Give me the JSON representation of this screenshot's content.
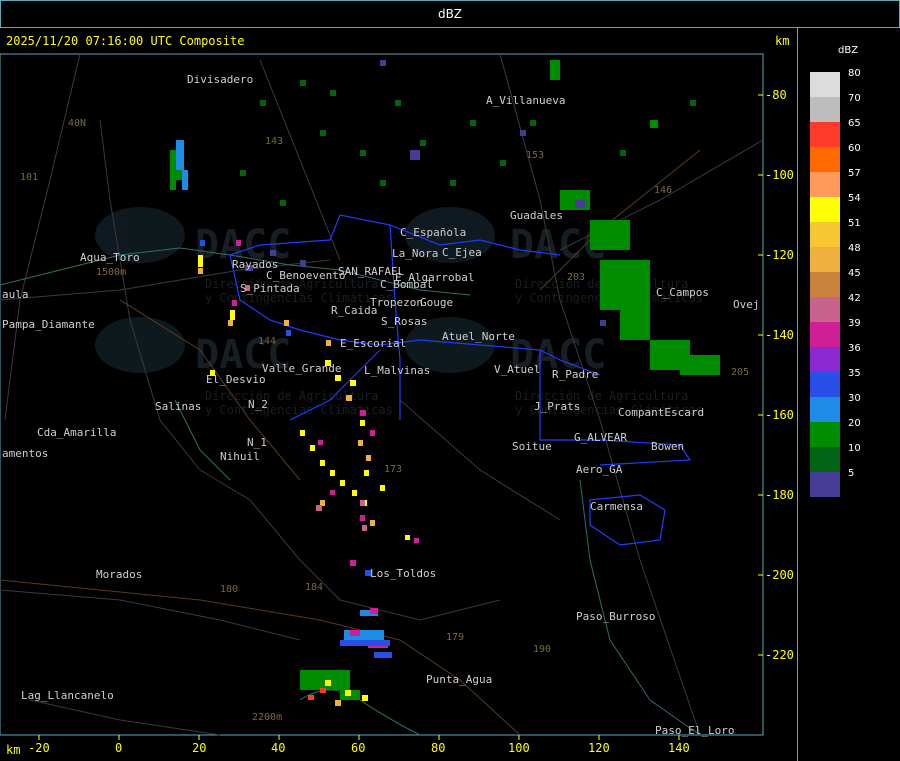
{
  "window": {
    "title": "dBZ"
  },
  "header": {
    "timestamp_label": "2025/11/20 07:16:00 UTC Composite",
    "unit_right": "km",
    "unit_bottom": "km"
  },
  "axes": {
    "x_ticks": [
      "-20",
      "0",
      "20",
      "40",
      "60",
      "80",
      "100",
      "120",
      "140"
    ],
    "y_ticks": [
      "-80",
      "-100",
      "-120",
      "-140",
      "-160",
      "-180",
      "-200",
      "-220"
    ]
  },
  "legend": {
    "title": "dBZ",
    "entries": [
      {
        "label": "80",
        "color": "#dcdcdc"
      },
      {
        "label": "70",
        "color": "#bdbdbd"
      },
      {
        "label": "65",
        "color": "#ff3a28"
      },
      {
        "label": "60",
        "color": "#ff6a00"
      },
      {
        "label": "57",
        "color": "#ff9a5a"
      },
      {
        "label": "54",
        "color": "#ffff00"
      },
      {
        "label": "51",
        "color": "#f8c832"
      },
      {
        "label": "48",
        "color": "#f0b040"
      },
      {
        "label": "45",
        "color": "#c8823c"
      },
      {
        "label": "42",
        "color": "#c8648c"
      },
      {
        "label": "39",
        "color": "#d01e96"
      },
      {
        "label": "36",
        "color": "#8c28d2"
      },
      {
        "label": "35",
        "color": "#2850e6"
      },
      {
        "label": "30",
        "color": "#1e8ce6"
      },
      {
        "label": "20",
        "color": "#008c00"
      },
      {
        "label": "10",
        "color": "#006414"
      },
      {
        "label": "5",
        "color": "#463c96"
      }
    ]
  },
  "places": [
    "Divisadero",
    "A_Villanueva",
    "Guadales",
    "C_Española",
    "La_Nora",
    "C_Ejea",
    "C_Campos",
    "Aqua_Toro",
    "Rayados",
    "C_Benoevento",
    "SAN_RAFAEL",
    "E_Algarrobal",
    "C_Bombal",
    "Tropezon",
    "Gouge",
    "S_Pintada",
    "R_Caida",
    "S_Rosas",
    "Atuel_Norte",
    "E_Escorial",
    "Valle_Grande",
    "L_Malvinas",
    "V_Atuel",
    "R_Padre",
    "El_Desvio",
    "Salinas",
    "N_2",
    "J_Prats",
    "CompantEscard",
    "Cda_Amarilla",
    "N_1",
    "Nihuil",
    "G_ALVEAR",
    "Soitue",
    "Bowen",
    "Aero_GA",
    "Carmensa",
    "Morados",
    "Los_Toldos",
    "Paso_Burroso",
    "Punta_Agua",
    "Lag_Llancanelo",
    "Paso_El_Loro",
    "Pampa_Diamante",
    "amentos",
    "aula",
    "Ovej"
  ],
  "route_numbers": [
    "143",
    "153",
    "146",
    "173",
    "184",
    "180",
    "179",
    "190",
    "101",
    "40N",
    "203",
    "205",
    "144",
    "2200m",
    "1500m"
  ],
  "watermark": {
    "org": "DACC",
    "line1": "Dirección de Agricultura",
    "line2": "y Contingencias Climáticas"
  }
}
